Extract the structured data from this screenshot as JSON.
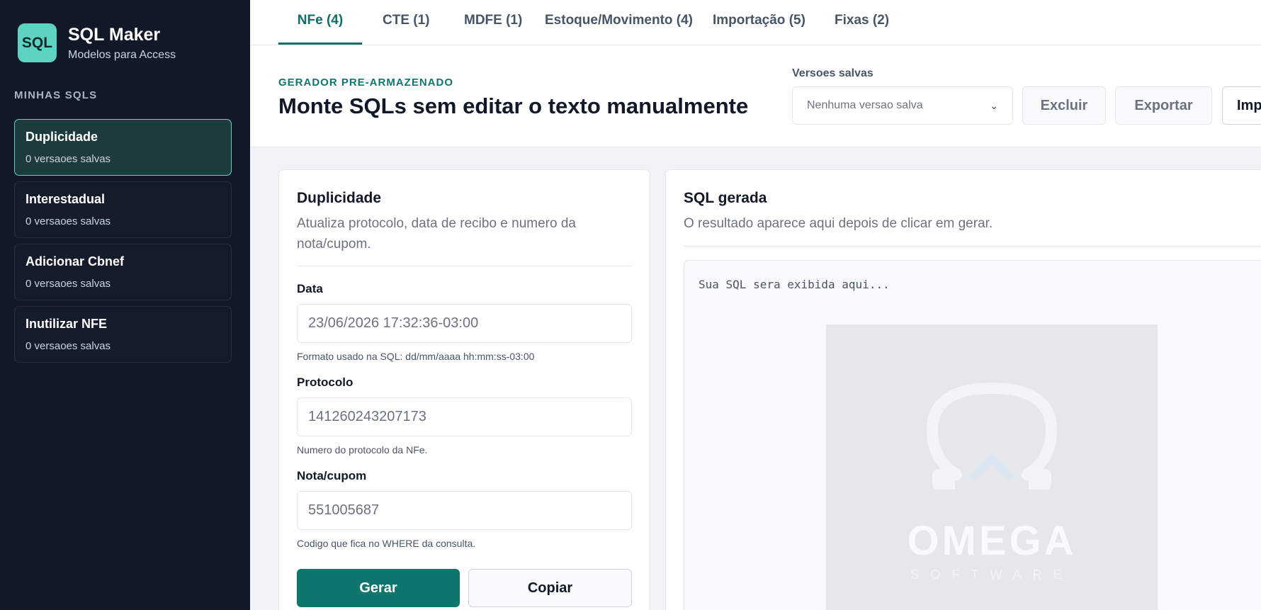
{
  "brand": {
    "logo_text": "SQL",
    "title": "SQL Maker",
    "subtitle": "Modelos para Access"
  },
  "sidebar": {
    "section_label": "MINHAS SQLS",
    "items": [
      {
        "title": "Duplicidade",
        "subtitle": "0 versaoes salvas",
        "active": true
      },
      {
        "title": "Interestadual",
        "subtitle": "0 versaoes salvas",
        "active": false
      },
      {
        "title": "Adicionar Cbnef",
        "subtitle": "0 versaoes salvas",
        "active": false
      },
      {
        "title": "Inutilizar NFE",
        "subtitle": "0 versaoes salvas",
        "active": false
      }
    ]
  },
  "tabs": [
    {
      "label": "NFe (4)",
      "active": true
    },
    {
      "label": "CTE (1)",
      "active": false
    },
    {
      "label": "MDFE (1)",
      "active": false
    },
    {
      "label": "Estoque/Movimento (4)",
      "active": false
    },
    {
      "label": "Importação (5)",
      "active": false
    },
    {
      "label": "Fixas (2)",
      "active": false
    }
  ],
  "header": {
    "eyebrow": "GERADOR PRE-ARMAZENADO",
    "title": "Monte SQLs sem editar o texto manualmente",
    "versions_label": "Versoes salvas",
    "versions_selected": "Nenhuma versao salva",
    "delete_label": "Excluir",
    "export_label": "Exportar",
    "import_label": "Imp"
  },
  "form": {
    "title": "Duplicidade",
    "description": "Atualiza protocolo, data de recibo e numero da nota/cupom.",
    "fields": [
      {
        "label": "Data",
        "value": "23/06/2026 17:32:36-03:00",
        "help": "Formato usado na SQL: dd/mm/aaaa hh:mm:ss-03:00"
      },
      {
        "label": "Protocolo",
        "value": "141260243207173",
        "help": "Numero do protocolo da NFe."
      },
      {
        "label": "Nota/cupom",
        "value": "551005687",
        "help": "Codigo que fica no WHERE da consulta."
      }
    ],
    "generate_label": "Gerar",
    "copy_label": "Copiar"
  },
  "sql_panel": {
    "title": "SQL gerada",
    "description": "O resultado aparece aqui depois de clicar em gerar.",
    "placeholder": "Sua SQL sera exibida aqui...",
    "watermark_text": "OMEGA",
    "watermark_sub": "SOFTWARE"
  },
  "colors": {
    "sidebar_bg": "#111827",
    "accent": "#0f766e",
    "logo_bg": "#5fd3c2"
  }
}
